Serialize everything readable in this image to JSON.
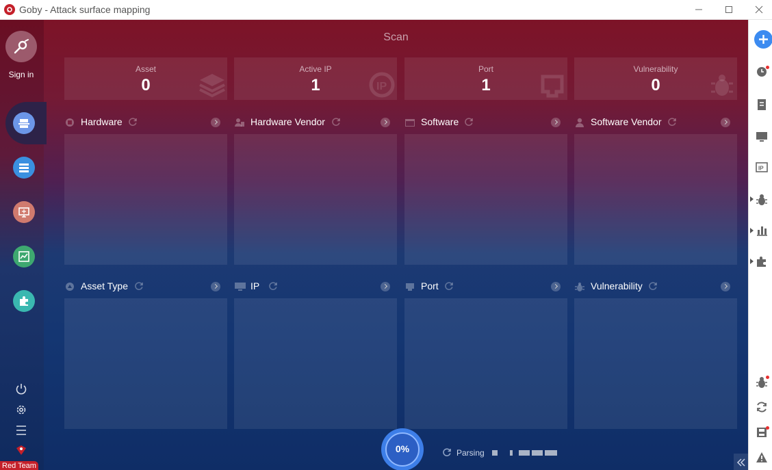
{
  "window": {
    "title": "Goby - Attack surface mapping"
  },
  "sidebar": {
    "sign_in": "Sign in",
    "nav_items": [
      {
        "icon": "scan-icon",
        "color": "#6c96e8"
      },
      {
        "icon": "list-icon",
        "color": "#3a90e0"
      },
      {
        "icon": "monitor-icon",
        "color": "#d07a6e"
      },
      {
        "icon": "chart-icon",
        "color": "#3ea870"
      },
      {
        "icon": "puzzle-icon",
        "color": "#3ab8b0"
      }
    ],
    "edition_badge": "Red Team"
  },
  "main": {
    "title": "Scan",
    "stats": [
      {
        "label": "Asset",
        "value": "0",
        "icon": "layers-icon"
      },
      {
        "label": "Active IP",
        "value": "1",
        "icon": "ip-icon"
      },
      {
        "label": "Port",
        "value": "1",
        "icon": "port-icon"
      },
      {
        "label": "Vulnerability",
        "value": "0",
        "icon": "bug-icon"
      }
    ],
    "sections": [
      {
        "title": "Hardware",
        "icon": "hardware-icon"
      },
      {
        "title": "Hardware Vendor",
        "icon": "vendor-icon"
      },
      {
        "title": "Software",
        "icon": "software-icon"
      },
      {
        "title": "Software Vendor",
        "icon": "user-icon"
      },
      {
        "title": "Asset Type",
        "icon": "asset-type-icon"
      },
      {
        "title": "IP",
        "icon": "ip-monitor-icon"
      },
      {
        "title": "Port",
        "icon": "port-icon"
      },
      {
        "title": "Vulnerability",
        "icon": "bug-icon"
      }
    ],
    "progress": "0%",
    "status": "Parsing"
  },
  "colors": {
    "brand_red": "#c4202a",
    "accent_blue": "#3c8bf0"
  }
}
